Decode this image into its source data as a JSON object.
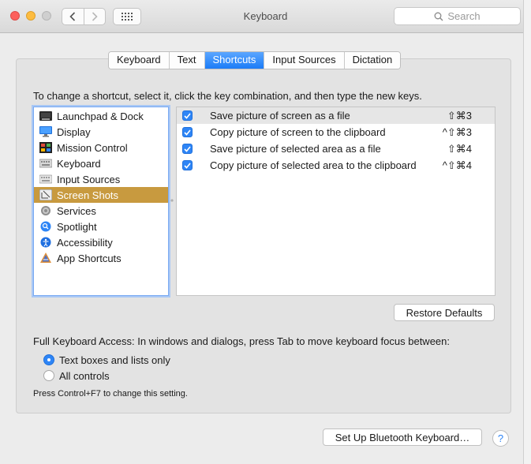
{
  "window": {
    "title": "Keyboard",
    "search_placeholder": "Search"
  },
  "tabs": [
    {
      "label": "Keyboard",
      "active": false
    },
    {
      "label": "Text",
      "active": false
    },
    {
      "label": "Shortcuts",
      "active": true
    },
    {
      "label": "Input Sources",
      "active": false
    },
    {
      "label": "Dictation",
      "active": false
    }
  ],
  "instructions": "To change a shortcut, select it, click the key combination, and then type the new keys.",
  "categories": [
    {
      "label": "Launchpad & Dock",
      "icon": "launchpad-icon"
    },
    {
      "label": "Display",
      "icon": "display-icon"
    },
    {
      "label": "Mission Control",
      "icon": "mission-control-icon"
    },
    {
      "label": "Keyboard",
      "icon": "keyboard-icon"
    },
    {
      "label": "Input Sources",
      "icon": "input-sources-icon"
    },
    {
      "label": "Screen Shots",
      "icon": "screenshot-icon",
      "selected": true
    },
    {
      "label": "Services",
      "icon": "gear-icon"
    },
    {
      "label": "Spotlight",
      "icon": "spotlight-icon"
    },
    {
      "label": "Accessibility",
      "icon": "accessibility-icon"
    },
    {
      "label": "App Shortcuts",
      "icon": "app-shortcuts-icon"
    }
  ],
  "shortcuts": [
    {
      "label": "Save picture of screen as a file",
      "keys": "⇧⌘3",
      "checked": true
    },
    {
      "label": "Copy picture of screen to the clipboard",
      "keys": "^⇧⌘3",
      "checked": true
    },
    {
      "label": "Save picture of selected area as a file",
      "keys": "⇧⌘4",
      "checked": true
    },
    {
      "label": "Copy picture of selected area to the clipboard",
      "keys": "^⇧⌘4",
      "checked": true
    }
  ],
  "restore_defaults": "Restore Defaults",
  "full_keyboard_access": {
    "label": "Full Keyboard Access: In windows and dialogs, press Tab to move keyboard focus between:",
    "options": [
      {
        "label": "Text boxes and lists only",
        "selected": true
      },
      {
        "label": "All controls",
        "selected": false
      }
    ],
    "hint": "Press Control+F7 to change this setting."
  },
  "bluetooth_button": "Set Up Bluetooth Keyboard…",
  "help_label": "?",
  "colors": {
    "accent": "#2e85f6",
    "selection": "#c89a3f"
  }
}
